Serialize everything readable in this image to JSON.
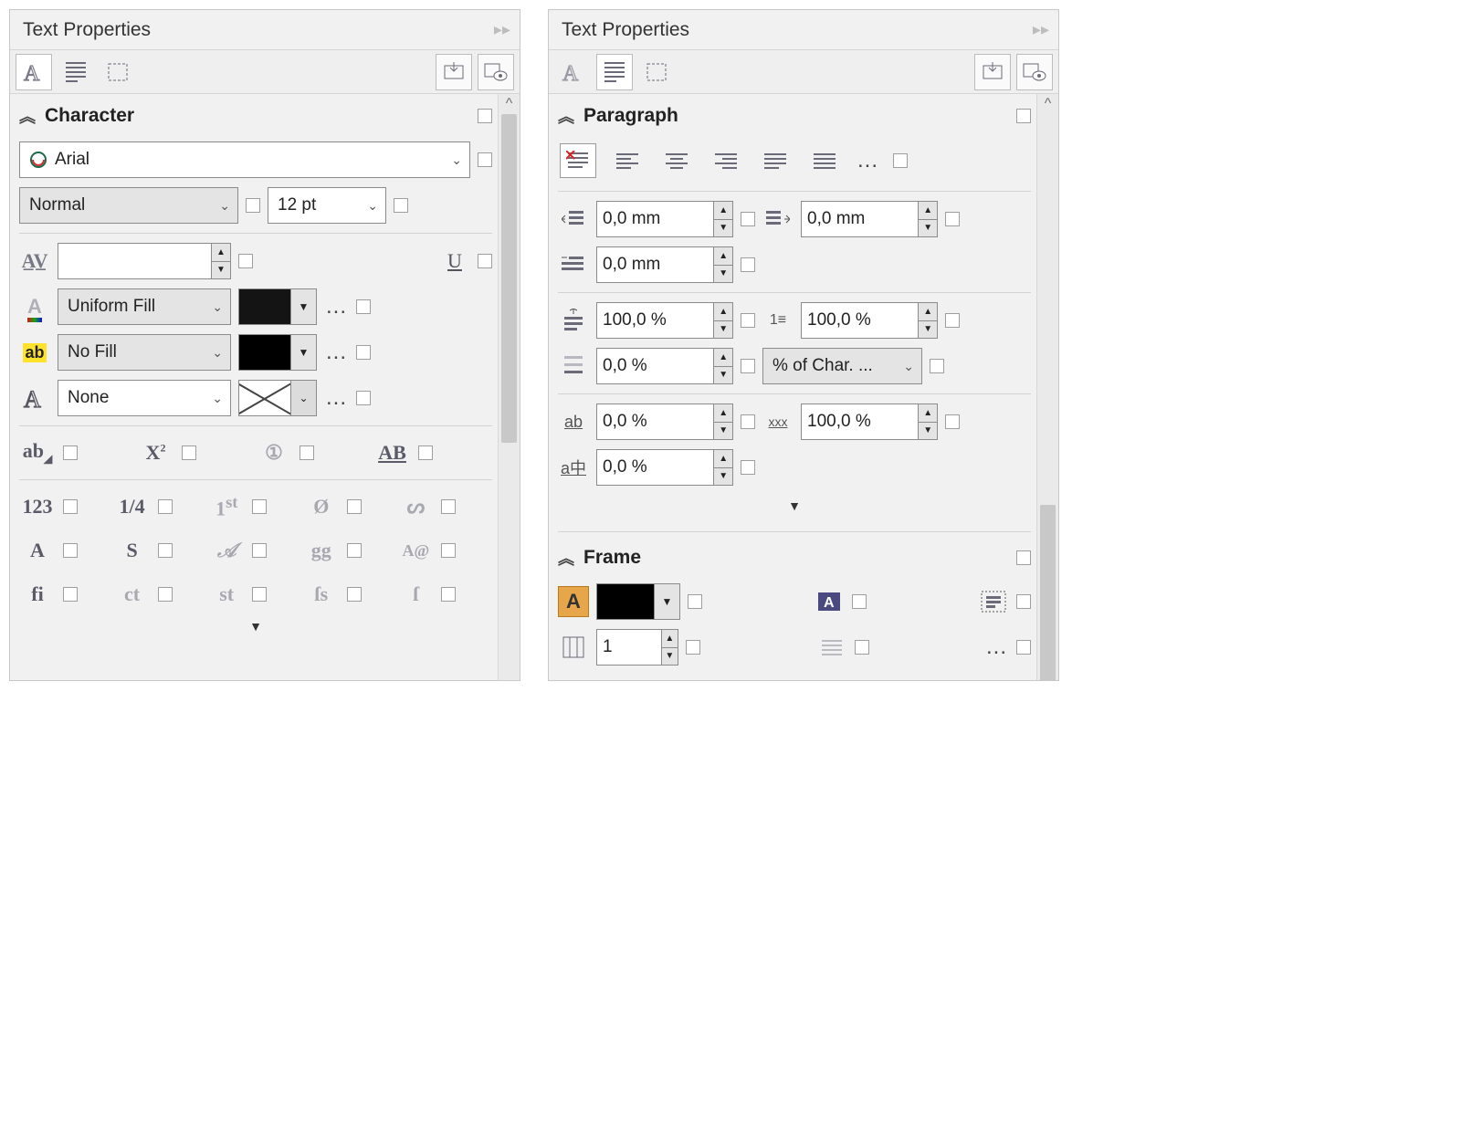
{
  "left": {
    "title": "Text Properties",
    "section": "Character",
    "font": "Arial",
    "style": "Normal",
    "size": "12 pt",
    "kerning": "",
    "fill_mode": "Uniform Fill",
    "bg_mode": "No Fill",
    "outline_mode": "None"
  },
  "right": {
    "title": "Text Properties",
    "section_paragraph": "Paragraph",
    "section_frame": "Frame",
    "indent_left": "0,0 mm",
    "indent_right": "0,0 mm",
    "indent_first": "0,0 mm",
    "before_pct": "100,0 %",
    "after_pct": "100,0 %",
    "line_pct": "0,0 %",
    "line_units": "% of Char. ...",
    "char_spacing": "0,0 %",
    "word_spacing": "100,0 %",
    "lang_spacing": "0,0 %",
    "columns": "1"
  }
}
